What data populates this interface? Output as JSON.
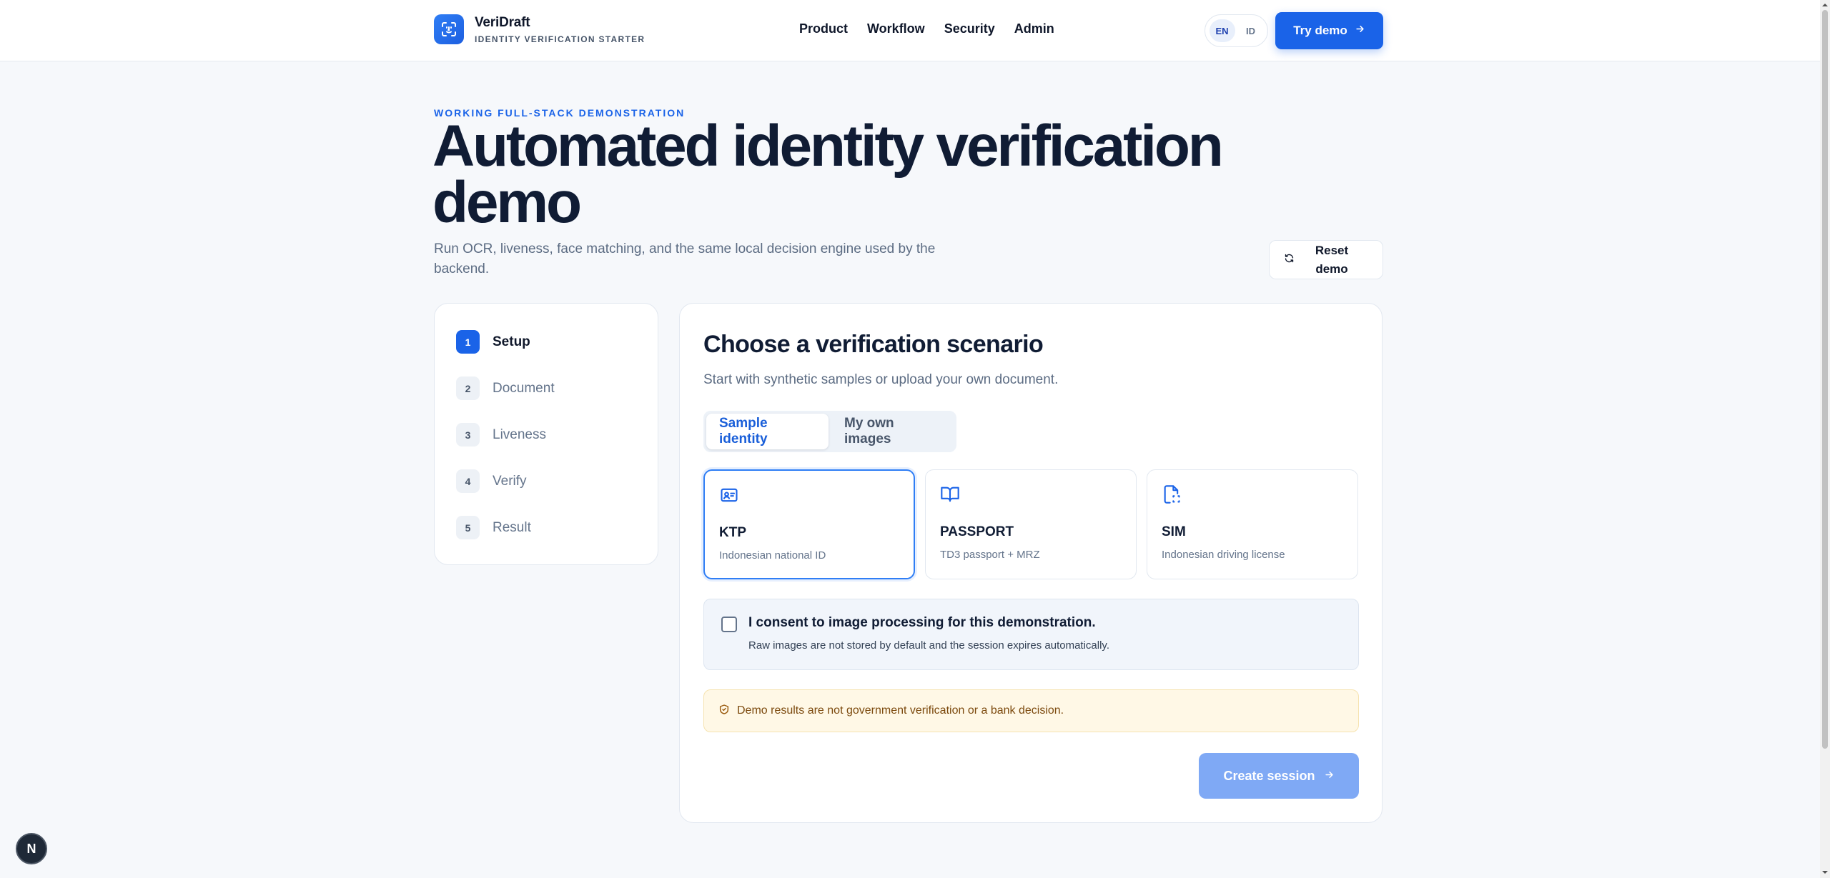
{
  "brand": {
    "name": "VeriDraft",
    "subtitle": "IDENTITY VERIFICATION STARTER"
  },
  "nav": {
    "items": [
      "Product",
      "Workflow",
      "Security",
      "Admin"
    ]
  },
  "lang": {
    "options": [
      "EN",
      "ID"
    ],
    "selected": "EN"
  },
  "header": {
    "try_demo_label": "Try demo"
  },
  "hero": {
    "eyebrow": "WORKING FULL-STACK DEMONSTRATION",
    "title": "Automated identity verification demo",
    "subtitle": "Run OCR, liveness, face matching, and the same local decision engine used by the backend.",
    "reset_label": "Reset demo"
  },
  "steps": [
    {
      "num": "1",
      "label": "Setup",
      "active": true
    },
    {
      "num": "2",
      "label": "Document"
    },
    {
      "num": "3",
      "label": "Liveness"
    },
    {
      "num": "4",
      "label": "Verify"
    },
    {
      "num": "5",
      "label": "Result"
    }
  ],
  "main": {
    "title": "Choose a verification scenario",
    "subtitle": "Start with synthetic samples or upload your own document.",
    "tabs": [
      {
        "label": "Sample identity",
        "active": true
      },
      {
        "label": "My own images"
      }
    ],
    "documents": [
      {
        "name": "KTP",
        "desc": "Indonesian national ID",
        "icon": "id-card-icon",
        "selected": true
      },
      {
        "name": "PASSPORT",
        "desc": "TD3 passport + MRZ",
        "icon": "book-open-icon"
      },
      {
        "name": "SIM",
        "desc": "Indonesian driving license",
        "icon": "file-scan-icon"
      }
    ],
    "consent": {
      "title": "I consent to image processing for this demonstration.",
      "note": "Raw images are not stored by default and the session expires automatically.",
      "checked": false
    },
    "warning": "Demo results are not government verification or a bank decision.",
    "create_label": "Create session"
  },
  "dev_badge": "N",
  "colors": {
    "accent": "#1a63e8",
    "accent_disabled": "#7fa9f5",
    "warning_bg": "#fff8e6"
  }
}
